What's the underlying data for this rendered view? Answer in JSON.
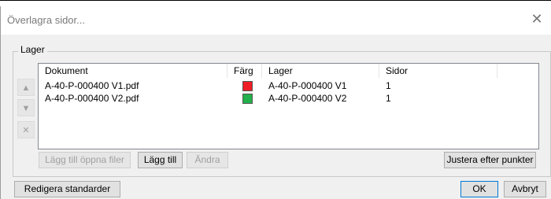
{
  "window": {
    "title": "Överlagra sidor...",
    "close_glyph": "✕"
  },
  "group": {
    "label": "Lager"
  },
  "table": {
    "headers": [
      "Dokument",
      "Färg",
      "Lager",
      "Sidor"
    ],
    "rows": [
      {
        "document": "A-40-P-000400 V1.pdf",
        "color": "#ee1c24",
        "layer": "A-40-P-000400 V1",
        "pages": "1"
      },
      {
        "document": "A-40-P-000400 V2.pdf",
        "color": "#22b14c",
        "layer": "A-40-P-000400 V2",
        "pages": "1"
      }
    ]
  },
  "side_buttons": {
    "up": {
      "icon": "arrow-up-icon",
      "glyph": "▲"
    },
    "down": {
      "icon": "arrow-down-icon",
      "glyph": "▼"
    },
    "remove": {
      "icon": "remove-x-icon",
      "glyph": "✕"
    }
  },
  "buttons": {
    "add_open_files": "Lägg till öppna filer",
    "add": "Lägg till",
    "change": "Ändra",
    "adjust_by_points": "Justera efter punkter",
    "edit_defaults": "Redigera standarder",
    "ok": "OK",
    "cancel": "Avbryt"
  }
}
